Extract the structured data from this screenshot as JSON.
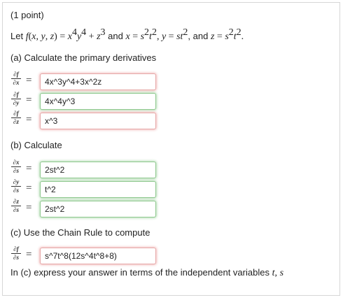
{
  "points": "(1 point)",
  "problem": {
    "let": "Let",
    "and_word": "and",
    "comma_and": ", and"
  },
  "part_a": {
    "heading": "(a) Calculate the primary derivatives",
    "rows": [
      {
        "num": "∂f",
        "den": "∂x",
        "value": "4x^3y^4+3x^2z",
        "status": "incorrect"
      },
      {
        "num": "∂f",
        "den": "∂y",
        "value": "4x^4y^3",
        "status": "correct"
      },
      {
        "num": "∂f",
        "den": "∂z",
        "value": "x^3",
        "status": "incorrect"
      }
    ]
  },
  "part_b": {
    "heading": "(b) Calculate",
    "rows": [
      {
        "num": "∂x",
        "den": "∂s",
        "value": "2st^2",
        "status": "correct"
      },
      {
        "num": "∂y",
        "den": "∂s",
        "value": "t^2",
        "status": "correct"
      },
      {
        "num": "∂z",
        "den": "∂s",
        "value": "2st^2",
        "status": "correct"
      }
    ]
  },
  "part_c": {
    "heading": "(c) Use the Chain Rule to compute",
    "row": {
      "num": "∂f",
      "den": "∂s",
      "value": "s^7t^8(12s^4t^8+8)",
      "status": "incorrect"
    },
    "note_prefix": "In (c) express your answer in terms of the independent variables",
    "note_var_t": "t",
    "note_comma": ",",
    "note_var_s": "s"
  },
  "status_colors": {
    "correct": "#5ab45a",
    "incorrect": "#e26e6e"
  }
}
